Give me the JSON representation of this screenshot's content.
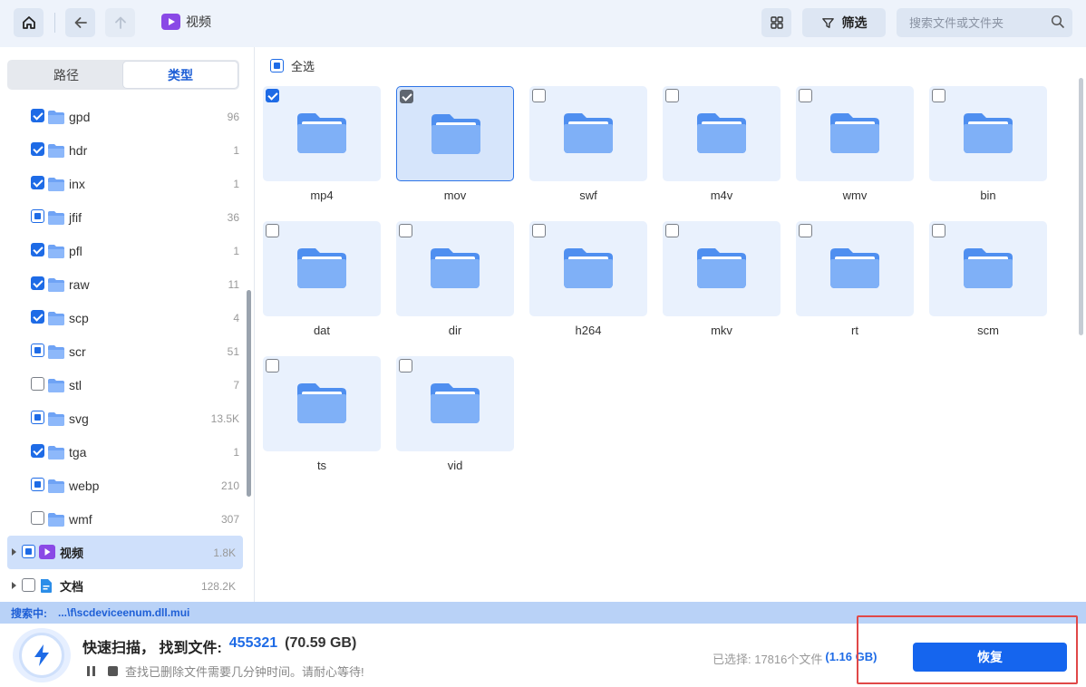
{
  "topbar": {
    "breadcrumb_label": "视频",
    "filter_label": "筛选",
    "search_placeholder": "搜索文件或文件夹"
  },
  "sidebar": {
    "tabs": [
      "路径",
      "类型"
    ],
    "active_tab": "类型",
    "items": [
      {
        "label": "gpd",
        "count": "96",
        "state": "checked"
      },
      {
        "label": "hdr",
        "count": "1",
        "state": "checked"
      },
      {
        "label": "inx",
        "count": "1",
        "state": "checked"
      },
      {
        "label": "jfif",
        "count": "36",
        "state": "partial"
      },
      {
        "label": "pfl",
        "count": "1",
        "state": "checked"
      },
      {
        "label": "raw",
        "count": "11",
        "state": "checked"
      },
      {
        "label": "scp",
        "count": "4",
        "state": "checked"
      },
      {
        "label": "scr",
        "count": "51",
        "state": "partial"
      },
      {
        "label": "stl",
        "count": "7",
        "state": "unchecked"
      },
      {
        "label": "svg",
        "count": "13.5K",
        "state": "partial"
      },
      {
        "label": "tga",
        "count": "1",
        "state": "checked"
      },
      {
        "label": "webp",
        "count": "210",
        "state": "partial"
      },
      {
        "label": "wmf",
        "count": "307",
        "state": "unchecked"
      }
    ],
    "groups": [
      {
        "label": "视频",
        "count": "1.8K",
        "state": "partial",
        "selected": true,
        "icon": "video-icon"
      },
      {
        "label": "文档",
        "count": "128.2K",
        "state": "unchecked",
        "selected": false,
        "icon": "document-icon"
      }
    ]
  },
  "main": {
    "select_all_label": "全选",
    "folders": [
      {
        "label": "mp4",
        "state": "checked"
      },
      {
        "label": "mov",
        "state": "grey-checked"
      },
      {
        "label": "swf",
        "state": "unchecked"
      },
      {
        "label": "m4v",
        "state": "unchecked"
      },
      {
        "label": "wmv",
        "state": "unchecked"
      },
      {
        "label": "bin",
        "state": "unchecked"
      },
      {
        "label": "dat",
        "state": "unchecked"
      },
      {
        "label": "dir",
        "state": "unchecked"
      },
      {
        "label": "h264",
        "state": "unchecked"
      },
      {
        "label": "mkv",
        "state": "unchecked"
      },
      {
        "label": "rt",
        "state": "unchecked"
      },
      {
        "label": "scm",
        "state": "unchecked"
      },
      {
        "label": "ts",
        "state": "unchecked"
      },
      {
        "label": "vid",
        "state": "unchecked"
      }
    ]
  },
  "status": {
    "searching_label": "搜索中:",
    "searching_path": "...\\f\\scdeviceenum.dll.mui"
  },
  "bottom": {
    "scan_title": "快速扫描， 找到文件:",
    "found_count": "455321",
    "found_size": "(70.59 GB)",
    "scan_hint": "查找已删除文件需要几分钟时间。请耐心等待!",
    "selected_label": "已选择: 17816个文件",
    "selected_size": "(1.16 GB)",
    "recover_label": "恢复"
  },
  "colors": {
    "accent": "#1e6be6",
    "recover_button": "#1565ee",
    "highlight_border": "#e04848",
    "folder": "#6fa3f5"
  }
}
